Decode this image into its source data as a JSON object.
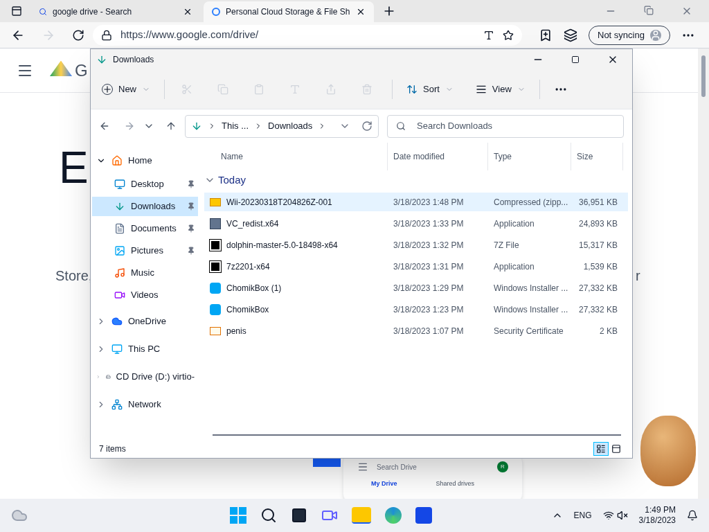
{
  "browser": {
    "tabs": [
      {
        "title": "google drive - Search",
        "selected": false
      },
      {
        "title": "Personal Cloud Storage & File Sh",
        "selected": true
      }
    ],
    "address": "https://www.google.com/drive/",
    "sync_label": "Not syncing"
  },
  "web_page": {
    "logo_text": "G",
    "heading": "E",
    "subtitle": "Store,",
    "subtitle_tail": "r",
    "preview": {
      "search_placeholder": "Search Drive",
      "avatar": "R",
      "tabs": [
        {
          "label": "My Drive",
          "selected": true
        },
        {
          "label": "Shared drives",
          "selected": false
        }
      ]
    }
  },
  "explorer": {
    "title": "Downloads",
    "toolbar": {
      "new_label": "New",
      "sort_label": "Sort",
      "view_label": "View"
    },
    "breadcrumb": [
      "This ...",
      "Downloads"
    ],
    "search_placeholder": "Search Downloads",
    "nav": [
      {
        "label": "Home",
        "kind": "home",
        "expanded": true,
        "selected": false,
        "children": [
          {
            "label": "Desktop",
            "kind": "desktop",
            "pinned": true,
            "selected": false
          },
          {
            "label": "Downloads",
            "kind": "downloads",
            "pinned": true,
            "selected": true
          },
          {
            "label": "Documents",
            "kind": "documents",
            "pinned": true,
            "selected": false
          },
          {
            "label": "Pictures",
            "kind": "pictures",
            "pinned": true,
            "selected": false
          },
          {
            "label": "Music",
            "kind": "music",
            "pinned": false,
            "selected": false
          },
          {
            "label": "Videos",
            "kind": "videos",
            "pinned": false,
            "selected": false
          }
        ]
      },
      {
        "label": "OneDrive",
        "kind": "cloud",
        "expanded": false,
        "selected": false
      },
      {
        "label": "This PC",
        "kind": "pc",
        "expanded": false,
        "selected": false
      },
      {
        "label": "CD Drive (D:) virtio-",
        "kind": "drive",
        "expanded": false,
        "selected": false
      },
      {
        "label": "Network",
        "kind": "network",
        "expanded": false,
        "selected": false
      }
    ],
    "columns": [
      "Name",
      "Date modified",
      "Type",
      "Size"
    ],
    "group": "Today",
    "files": [
      {
        "name": "Wii-20230318T204826Z-001",
        "date": "3/18/2023 1:48 PM",
        "type": "Compressed (zipp...",
        "size": "36,951 KB",
        "kind": "zip",
        "selected": true
      },
      {
        "name": "VC_redist.x64",
        "date": "3/18/2023 1:33 PM",
        "type": "Application",
        "size": "24,893 KB",
        "kind": "setup",
        "selected": false
      },
      {
        "name": "dolphin-master-5.0-18498-x64",
        "date": "3/18/2023 1:32 PM",
        "type": "7Z File",
        "size": "15,317 KB",
        "kind": "archive",
        "selected": false
      },
      {
        "name": "7z2201-x64",
        "date": "3/18/2023 1:31 PM",
        "type": "Application",
        "size": "1,539 KB",
        "kind": "archive",
        "selected": false
      },
      {
        "name": "ChomikBox (1)",
        "date": "3/18/2023 1:29 PM",
        "type": "Windows Installer ...",
        "size": "27,332 KB",
        "kind": "msi",
        "selected": false
      },
      {
        "name": "ChomikBox",
        "date": "3/18/2023 1:23 PM",
        "type": "Windows Installer ...",
        "size": "27,332 KB",
        "kind": "msi",
        "selected": false
      },
      {
        "name": "penis",
        "date": "3/18/2023 1:07 PM",
        "type": "Security Certificate",
        "size": "2 KB",
        "kind": "cert",
        "selected": false
      }
    ],
    "status": "7 items",
    "views": [
      {
        "kind": "details",
        "selected": true
      },
      {
        "kind": "tiles",
        "selected": false
      }
    ]
  },
  "taskbar": {
    "language": "ENG",
    "time": "1:49 PM",
    "date": "3/18/2023"
  }
}
